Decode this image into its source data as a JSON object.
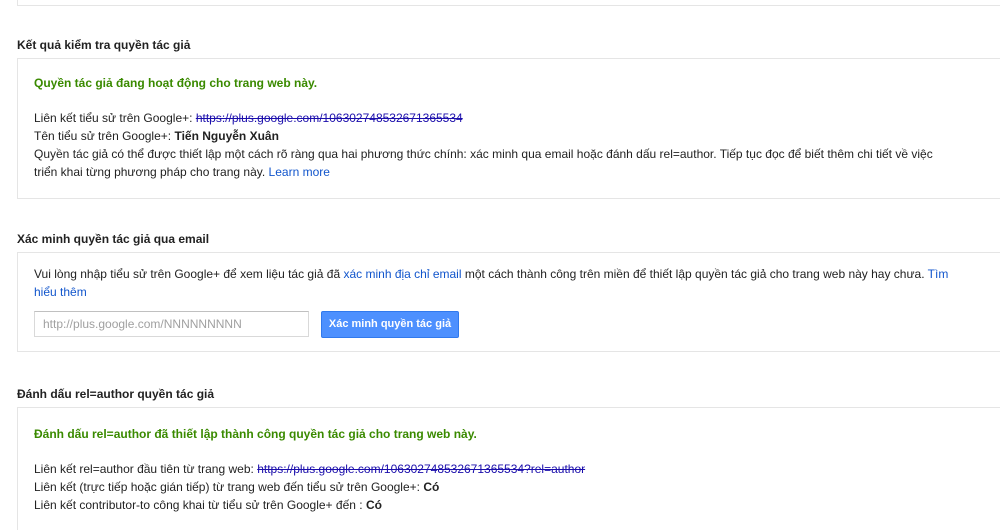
{
  "result_section": {
    "title": "Kết quả kiểm tra quyền tác giả",
    "status": "Quyền tác giả đang hoạt động cho trang web này.",
    "profile_link_label": "Liên kết tiểu sử trên Google+:",
    "profile_link_url": "https://plus.google.com/106302748532671365534",
    "profile_name_label": "Tên tiểu sử trên Google+:",
    "profile_name_value": "Tiến Nguyễn Xuân",
    "description_line1": "Quyền tác giả có thể được thiết lập một cách rõ ràng qua hai phương thức chính: xác minh qua email hoặc đánh dấu rel=author. Tiếp tục đọc để biết thêm chi tiết về việc",
    "description_line2": "triển khai từng phương pháp cho trang này.",
    "learn_more": "Learn more"
  },
  "email_section": {
    "title": "Xác minh quyền tác giả qua email",
    "text_before_link": "Vui lòng nhập tiểu sử trên Google+ để xem liệu tác giả đã",
    "verify_link": "xác minh địa chỉ email",
    "text_after_link": "một cách thành công trên miền  để thiết lập quyền tác giả cho trang web này hay chưa.",
    "find_more_part1": "Tìm",
    "find_more_part2": "hiểu thêm",
    "input_placeholder": "http://plus.google.com/NNNNNNNNN",
    "input_value": "",
    "button_label": "Xác minh quyền tác giả"
  },
  "relauthor_section": {
    "title": "Đánh dấu rel=author quyền tác giả",
    "status": "Đánh dấu rel=author đã thiết lập thành công quyền tác giả cho trang web này.",
    "first_link_label": "Liên kết rel=author đầu tiên từ trang web:",
    "first_link_url": "https://plus.google.com/106302748532671365534?rel=author",
    "direct_link_label": "Liên kết (trực tiếp hoặc gián tiếp) từ trang web đến tiểu sử trên Google+:",
    "direct_link_value": "Có",
    "contributor_label": "Liên kết contributor-to công khai từ tiểu sử trên Google+ đến :",
    "contributor_value": "Có"
  },
  "colors": {
    "success_green": "#3a8a00",
    "link_blue": "#1155cc",
    "button_blue": "#4d90fe",
    "border_gray": "#e5e5e5"
  }
}
